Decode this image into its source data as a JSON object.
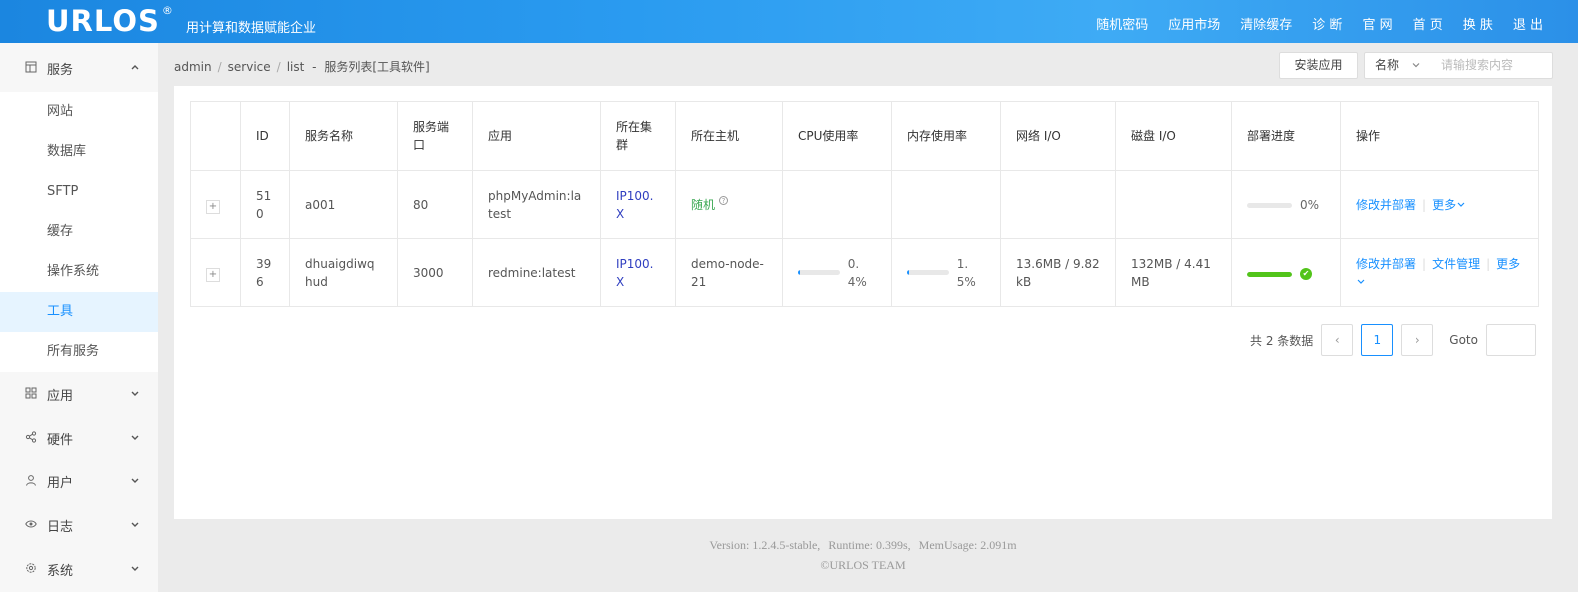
{
  "header": {
    "logo": "URLOS",
    "logo_mark": "®",
    "tagline": "用计算和数据赋能企业",
    "nav": [
      "随机密码",
      "应用市场",
      "清除缓存",
      "诊 断",
      "官 网",
      "首 页",
      "换 肤",
      "退 出"
    ]
  },
  "sidebar": {
    "service": {
      "label": "服务",
      "icon": "grid-box-icon",
      "expanded": true,
      "items": [
        "网站",
        "数据库",
        "SFTP",
        "缓存",
        "操作系统",
        "工具",
        "所有服务"
      ],
      "active": "工具"
    },
    "groups": [
      {
        "label": "应用",
        "icon": "apps-icon"
      },
      {
        "label": "硬件",
        "icon": "share-nodes-icon"
      },
      {
        "label": "用户",
        "icon": "user-icon"
      },
      {
        "label": "日志",
        "icon": "eye-icon"
      },
      {
        "label": "系统",
        "icon": "gear-icon"
      }
    ]
  },
  "breadcrumb": {
    "parts": [
      "admin",
      "service",
      "list"
    ],
    "dash": "-",
    "current": "服务列表[工具软件]"
  },
  "toolbar": {
    "install_label": "安装应用",
    "select_value": "名称",
    "search_placeholder": "请输搜索内容"
  },
  "table": {
    "headers": [
      "ID",
      "服务名称",
      "服务端口",
      "应用",
      "所在集群",
      "所在主机",
      "CPU使用率",
      "内存使用率",
      "网络 I/O",
      "磁盘 I/O",
      "部署进度",
      "操作"
    ],
    "rows": [
      {
        "id": "510",
        "name": "a001",
        "port": "80",
        "app": "phpMyAdmin:latest",
        "cluster": "IP100.X",
        "host": "随机",
        "host_help": "?",
        "cpu": "",
        "mem": "",
        "net": "",
        "disk": "",
        "deploy_pct": "0%",
        "deploy_value": 0,
        "ops": [
          "修改并部署",
          "更多"
        ]
      },
      {
        "id": "396",
        "name": "dhuaigdiwqhud",
        "port": "3000",
        "app": "redmine:latest",
        "cluster": "IP100.X",
        "host": "demo-node-21",
        "cpu": "0.4%",
        "cpu_value": 0.004,
        "mem": "1.5%",
        "mem_value": 0.015,
        "net": "13.6MB / 9.82 kB",
        "disk": "132MB / 4.41 MB",
        "deploy_value": 1,
        "deploy_done": true,
        "ops": [
          "修改并部署",
          "文件管理",
          "更多"
        ]
      }
    ]
  },
  "pagination": {
    "total_text": "共 2 条数据",
    "current_page": "1",
    "goto_label": "Goto",
    "prev": "‹",
    "next": "›"
  },
  "footer": {
    "version": "Version: 1.2.4.5-stable,",
    "runtime": "Runtime: 0.399s,",
    "mem": "MemUsage: 2.091m",
    "team": "©URLOS TEAM"
  },
  "colors": {
    "accent": "#1890ff",
    "header": "#2a9bf0",
    "success": "#52c41a",
    "cluster": "#2f3ec0",
    "host_random": "#3aa852"
  }
}
